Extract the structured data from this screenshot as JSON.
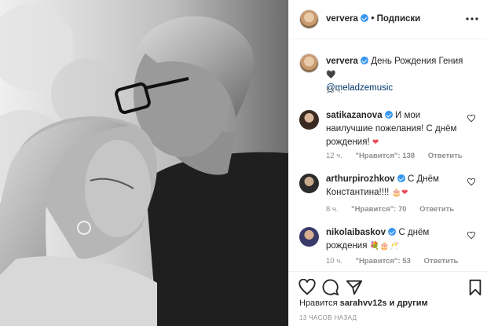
{
  "header": {
    "username": "ververa",
    "separator": "•",
    "follow_label": "Подписки",
    "more_icon": "ellipsis-icon"
  },
  "caption": {
    "username": "ververa",
    "text": "День Рождения Гения",
    "emoji": "🖤",
    "mention": "@meladzemusic",
    "time": "13 ч."
  },
  "comments": [
    {
      "username": "satikazanova",
      "text": "И мои наилучшие пожелания! С днём рождения!",
      "emoji": "❤",
      "time": "12 ч.",
      "likes": "\"Нравится\": 138",
      "reply": "Ответить"
    },
    {
      "username": "arthurpirozhkov",
      "text": "С Днём Константина!!!!",
      "emoji": "🎂❤",
      "time": "8 ч.",
      "likes": "\"Нравится\": 70",
      "reply": "Ответить"
    },
    {
      "username": "nikolaibaskov",
      "text": "С днём рождения",
      "emoji": "💐🎂🥂",
      "time": "10 ч.",
      "likes": "\"Нравится\": 53",
      "reply": "Ответить"
    }
  ],
  "footer": {
    "likes_prefix": "Нравится",
    "likes_user": "sarahvv12s",
    "likes_suffix": "и другим",
    "timestamp": "13 ЧАСОВ НАЗАД"
  },
  "colors": {
    "verified": "#3897f0",
    "link": "#00376b",
    "meta": "#8e8e8e",
    "border": "#efefef",
    "heart_red": "#ed4956"
  }
}
